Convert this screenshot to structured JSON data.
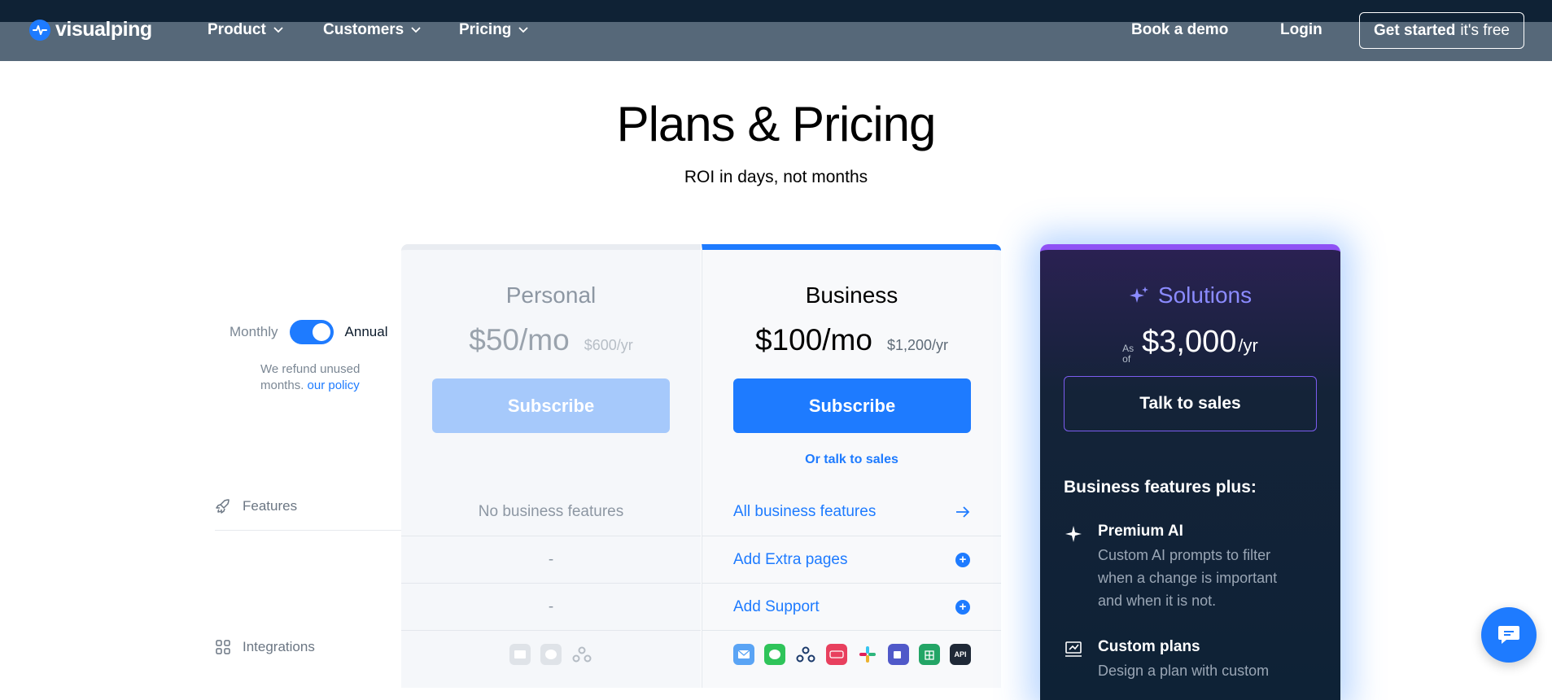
{
  "nav": {
    "logo": "visualping",
    "items": [
      {
        "label": "Product"
      },
      {
        "label": "Customers"
      },
      {
        "label": "Pricing"
      }
    ],
    "book_demo": "Book a demo",
    "login": "Login",
    "cta_main": "Get started",
    "cta_sub": "it's free"
  },
  "hero": {
    "title": "Plans & Pricing",
    "subtitle": "ROI in days, not months"
  },
  "billing": {
    "monthly": "Monthly",
    "annual": "Annual",
    "refund_text": "We refund unused months.",
    "policy_link": "our policy"
  },
  "sidebar": {
    "features": "Features",
    "integrations": "Integrations"
  },
  "plans": {
    "personal": {
      "name": "Personal",
      "price": "$50/mo",
      "price_yr": "$600/yr",
      "subscribe": "Subscribe",
      "features": "No business features",
      "extra_pages": "-",
      "support": "-"
    },
    "business": {
      "name": "Business",
      "price": "$100/mo",
      "price_yr": "$1,200/yr",
      "subscribe": "Subscribe",
      "talk_link": "Or talk to sales",
      "features": "All business features",
      "extra_pages": "Add Extra pages",
      "support": "Add Support",
      "api_label": "API"
    },
    "solutions": {
      "name": "Solutions",
      "as_of": "As of",
      "price": "$3,000",
      "per": "/yr",
      "talk_sales": "Talk to sales",
      "plus_heading": "Business features plus:",
      "features": [
        {
          "title": "Premium AI",
          "desc": "Custom AI prompts to filter when a change is important and when it is not."
        },
        {
          "title": "Custom plans",
          "desc": "Design a plan with custom"
        }
      ]
    }
  },
  "colors": {
    "accent": "#1e7bff",
    "solutions_accent": "#8f52f5",
    "nav_dark": "#0f2235"
  }
}
